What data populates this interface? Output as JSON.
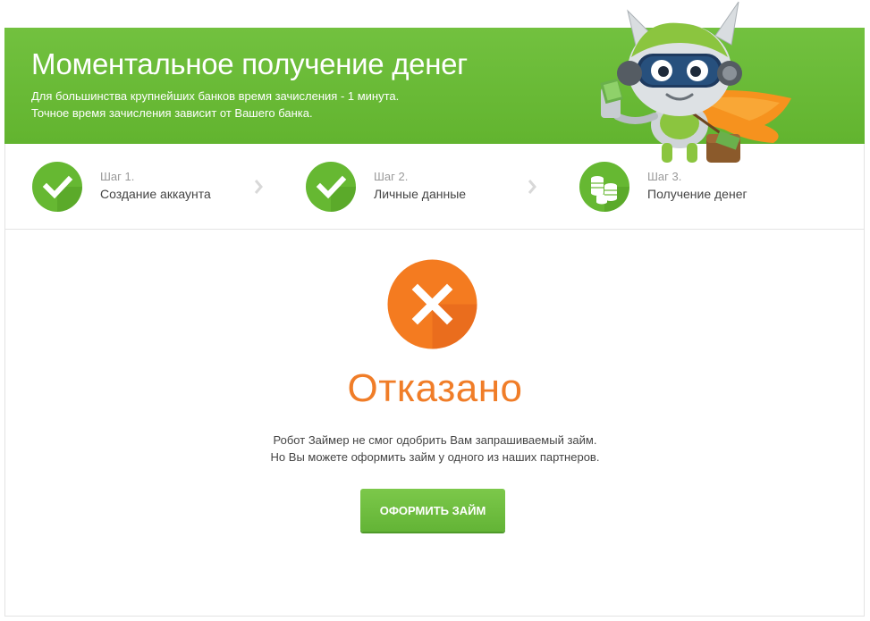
{
  "banner": {
    "title": "Моментальное получение денег",
    "subtitle_line1": "Для большинства крупнейших банков время зачисления - 1 минута.",
    "subtitle_line2": "Точное время зачисления зависит от Вашего банка."
  },
  "steps": [
    {
      "number": "Шаг 1.",
      "name": "Создание аккаунта",
      "status": "done",
      "icon": "check-icon"
    },
    {
      "number": "Шаг 2.",
      "name": "Личные данные",
      "status": "done",
      "icon": "check-icon"
    },
    {
      "number": "Шаг 3.",
      "name": "Получение денег",
      "status": "current",
      "icon": "coins-icon"
    }
  ],
  "result": {
    "icon": "close-icon",
    "title": "Отказано",
    "message_line1": "Робот Займер не смог одобрить Вам запрашиваемый займ.",
    "message_line2": "Но Вы можете оформить займ у одного из наших партнеров."
  },
  "cta": {
    "label": "ОФОРМИТЬ ЗАЙМ"
  },
  "colors": {
    "brand_green": "#66b832",
    "reject_orange": "#f47b20",
    "title_orange": "#f07d28"
  }
}
